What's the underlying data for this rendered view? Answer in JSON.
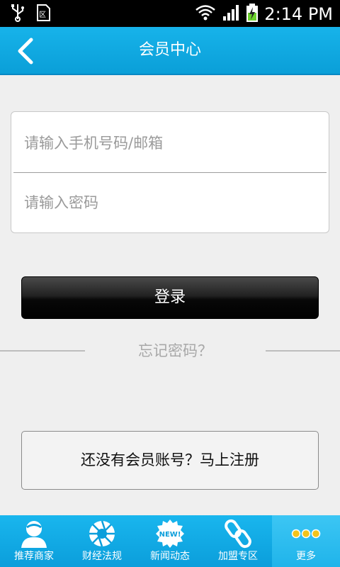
{
  "status_bar": {
    "time": "2:14 PM"
  },
  "header": {
    "title": "会员中心"
  },
  "login": {
    "phone_placeholder": "请输入手机号码/邮箱",
    "password_placeholder": "请输入密码",
    "login_label": "登录",
    "forgot_label": "忘记密码？"
  },
  "register": {
    "label": "还没有会员账号？马上注册"
  },
  "tabs": [
    {
      "label": "推荐商家",
      "icon": "user-icon"
    },
    {
      "label": "财经法规",
      "icon": "shutter-icon"
    },
    {
      "label": "新闻动态",
      "icon": "new-badge-icon",
      "badge": "NEW!"
    },
    {
      "label": "加盟专区",
      "icon": "chain-link-icon"
    },
    {
      "label": "更多",
      "icon": "more-dots-icon"
    }
  ],
  "colors": {
    "accent": "#0ea6e0",
    "active_tab": "#2fbdf0"
  }
}
